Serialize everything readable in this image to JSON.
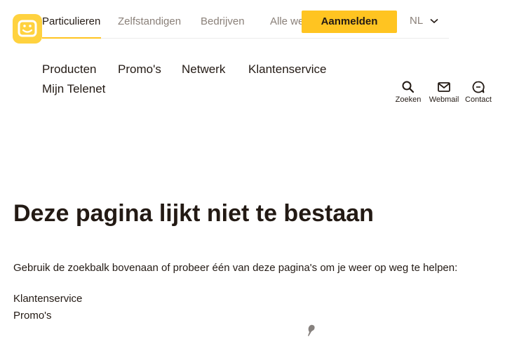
{
  "top_nav": {
    "tabs": [
      {
        "label": "Particulieren",
        "active": true
      },
      {
        "label": "Zelfstandigen",
        "active": false
      },
      {
        "label": "Bedrijven",
        "active": false
      },
      {
        "label": "Alle we",
        "active": false
      }
    ],
    "login_label": "Aanmelden",
    "language": "NL"
  },
  "main_nav": {
    "items": [
      "Producten",
      "Promo's",
      "Netwerk",
      "Klantenservice",
      "Mijn Telenet"
    ]
  },
  "utility_nav": {
    "items": [
      {
        "label": "Zoeken",
        "icon": "search-icon"
      },
      {
        "label": "Webmail",
        "icon": "mail-icon"
      },
      {
        "label": "Contact",
        "icon": "chat-icon"
      }
    ]
  },
  "content": {
    "title": "Deze pagina lijkt niet te bestaan",
    "intro": "Gebruik de zoekbalk bovenaan of probeer één van deze pagina's om je weer op weg te helpen:",
    "links": [
      "Klantenservice",
      "Promo's"
    ]
  },
  "colors": {
    "brand_yellow": "#ffc421",
    "text_dark": "#231a14",
    "text_muted": "#8a8079"
  }
}
